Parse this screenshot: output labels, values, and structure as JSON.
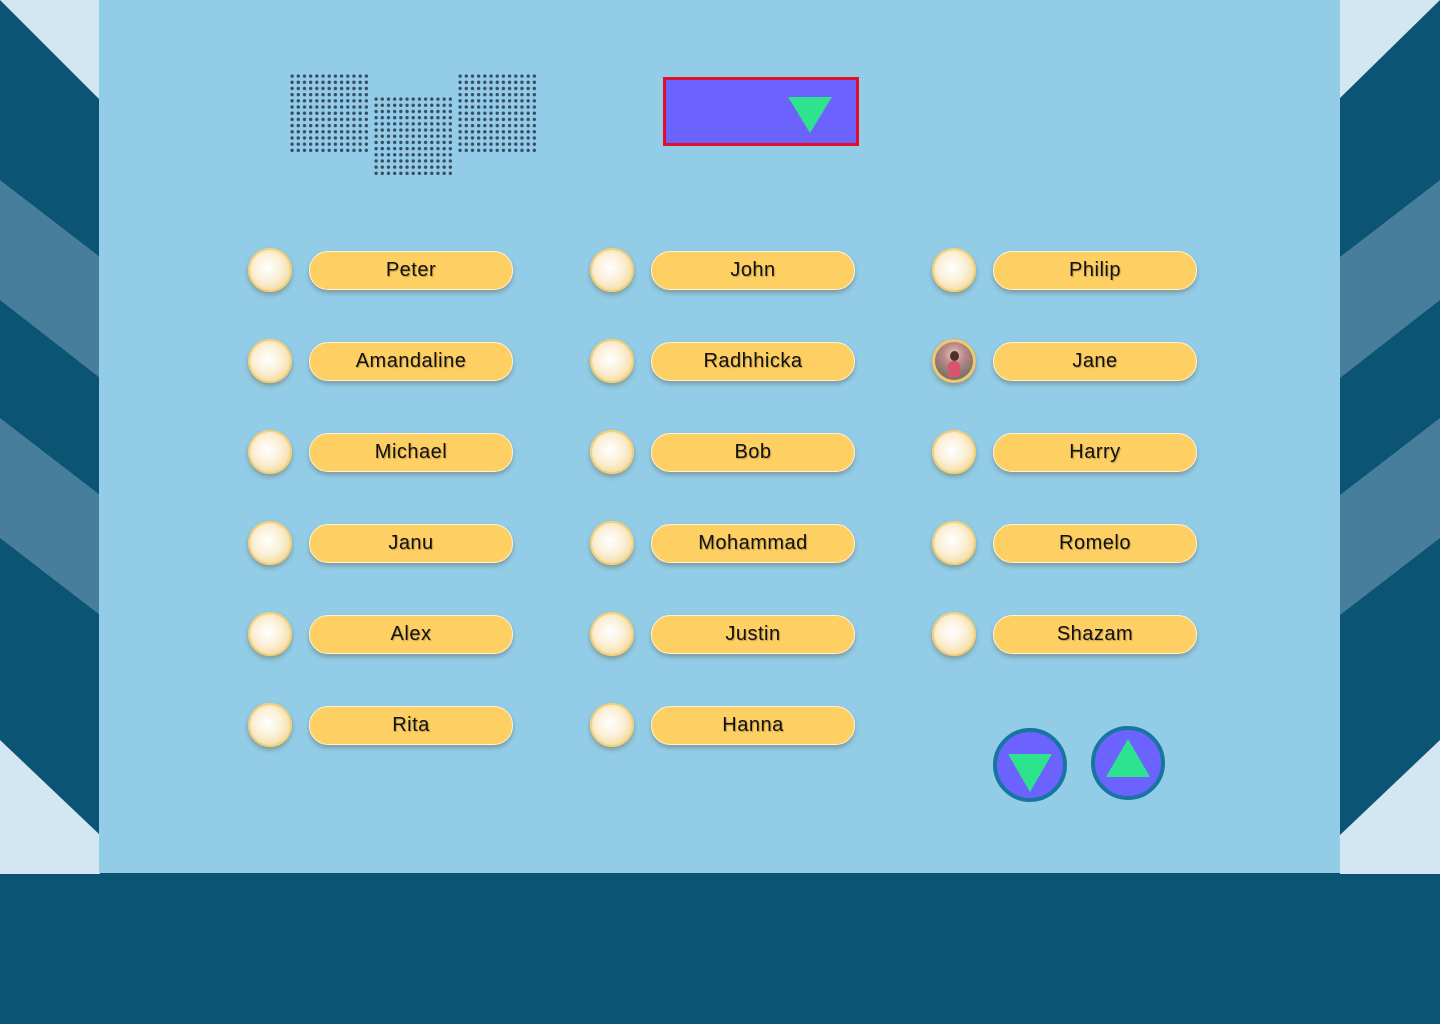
{
  "colors": {
    "background": "#92cce6",
    "frame": "#0b5474",
    "accent": "#6c63ff",
    "arrow": "#2de38e",
    "name_button": "#fecf62",
    "highlight_border": "#e0102a"
  },
  "dropdown": {
    "icon": "triangle-down-icon",
    "selected": ""
  },
  "names": {
    "col1": [
      "Peter",
      "Amandaline",
      "Michael",
      "Janu",
      "Alex",
      "Rita"
    ],
    "col2": [
      "John",
      "Radhhicka",
      "Bob",
      "Mohammad",
      "Justin",
      "Hanna"
    ],
    "col3": [
      "Philip",
      "Jane",
      "Harry",
      "Romelo",
      "Shazam"
    ]
  },
  "selected_name": "Jane",
  "nav": {
    "down_icon": "triangle-down-icon",
    "up_icon": "triangle-up-icon"
  }
}
